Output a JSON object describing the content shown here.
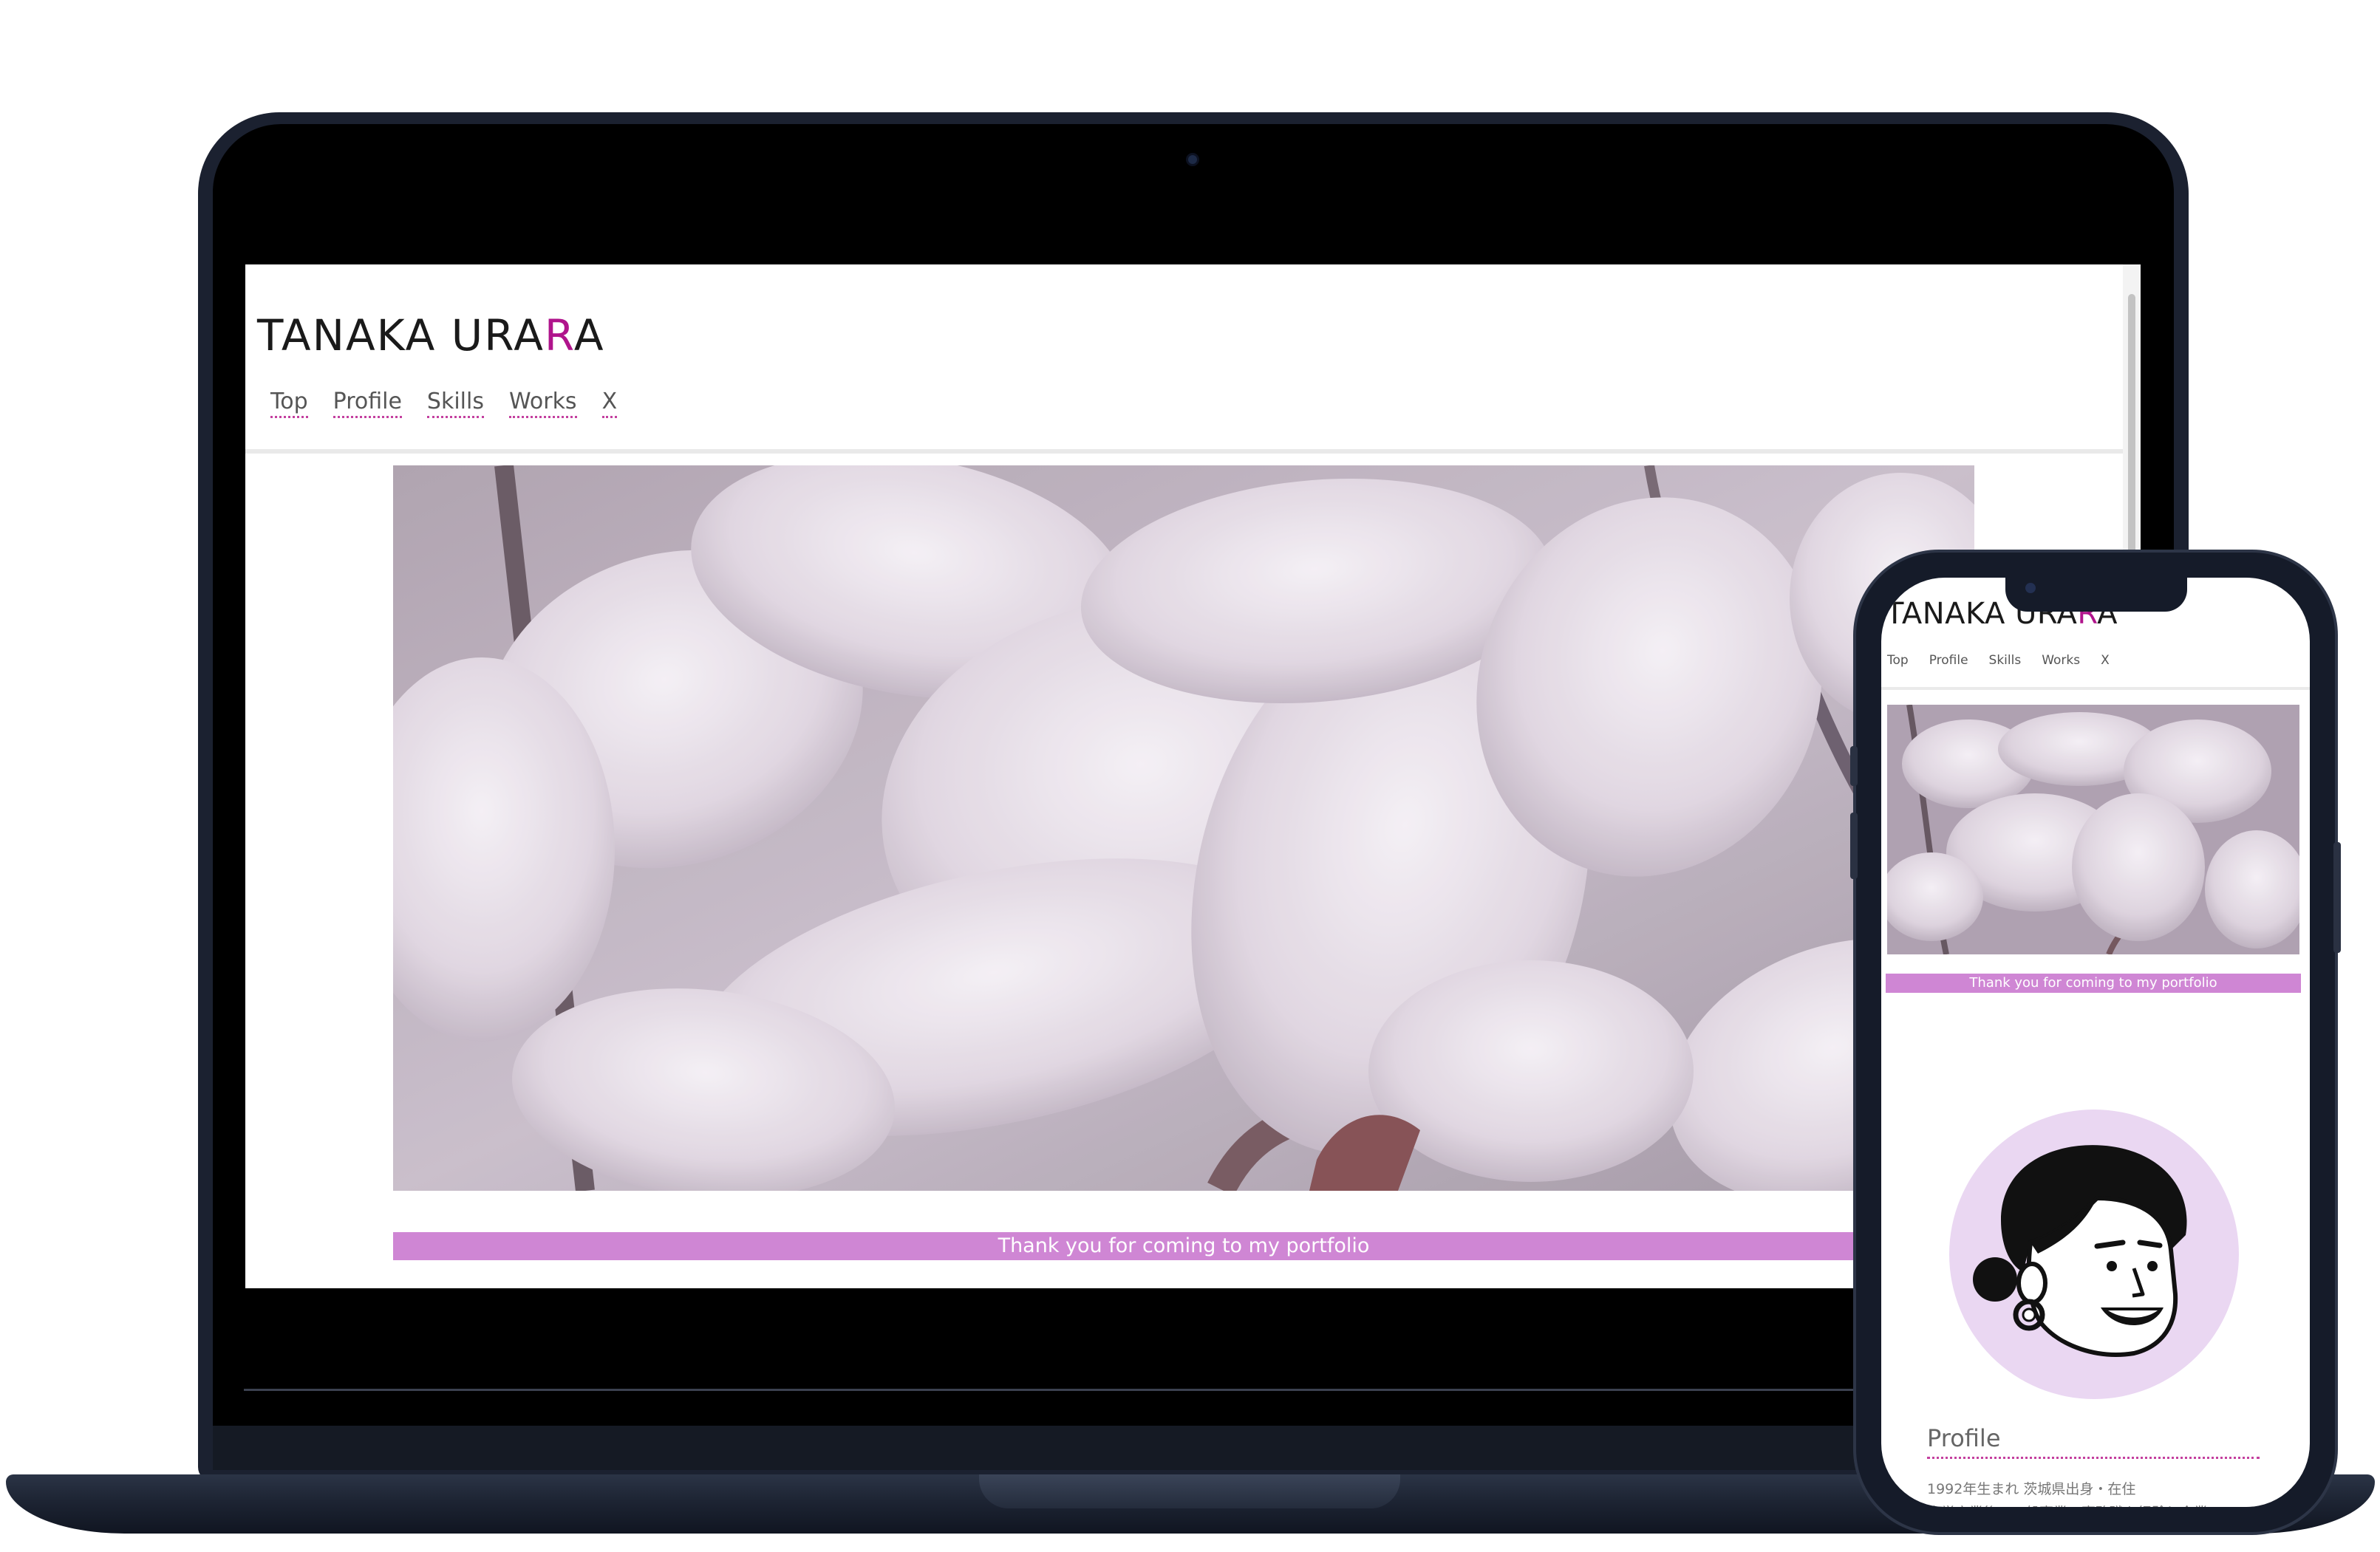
{
  "laptop_site": {
    "logo": {
      "main": "TANAKA URA",
      "accent": "R",
      "tail": "A"
    },
    "nav": [
      {
        "label": "Top"
      },
      {
        "label": "Profile"
      },
      {
        "label": "Skills"
      },
      {
        "label": "Works"
      },
      {
        "label": "X"
      }
    ],
    "banner_text": "Thank you for coming to my portfolio",
    "hero_image": "magnolia-photo"
  },
  "phone_site": {
    "logo": {
      "main": "TANAKA URA",
      "accent": "R",
      "tail": "A"
    },
    "nav": [
      {
        "label": "Top"
      },
      {
        "label": "Profile"
      },
      {
        "label": "Skills"
      },
      {
        "label": "Works"
      },
      {
        "label": "X"
      }
    ],
    "banner_text": "Thank you for coming to my portfolio",
    "avatar": "illustrated-woman-portrait",
    "profile_heading": "Profile",
    "profile_text": "1992年生まれ 茨城県出身・在住",
    "profile_text_cut": "大学卒業後、一般事業・事務職を経験し全業"
  },
  "colors": {
    "accent": "#b0148c",
    "banner": "#cf86d4",
    "nav_underline": "#c4409f",
    "avatar_bg": "#ead7f2",
    "device_frame": "#1b2130"
  }
}
